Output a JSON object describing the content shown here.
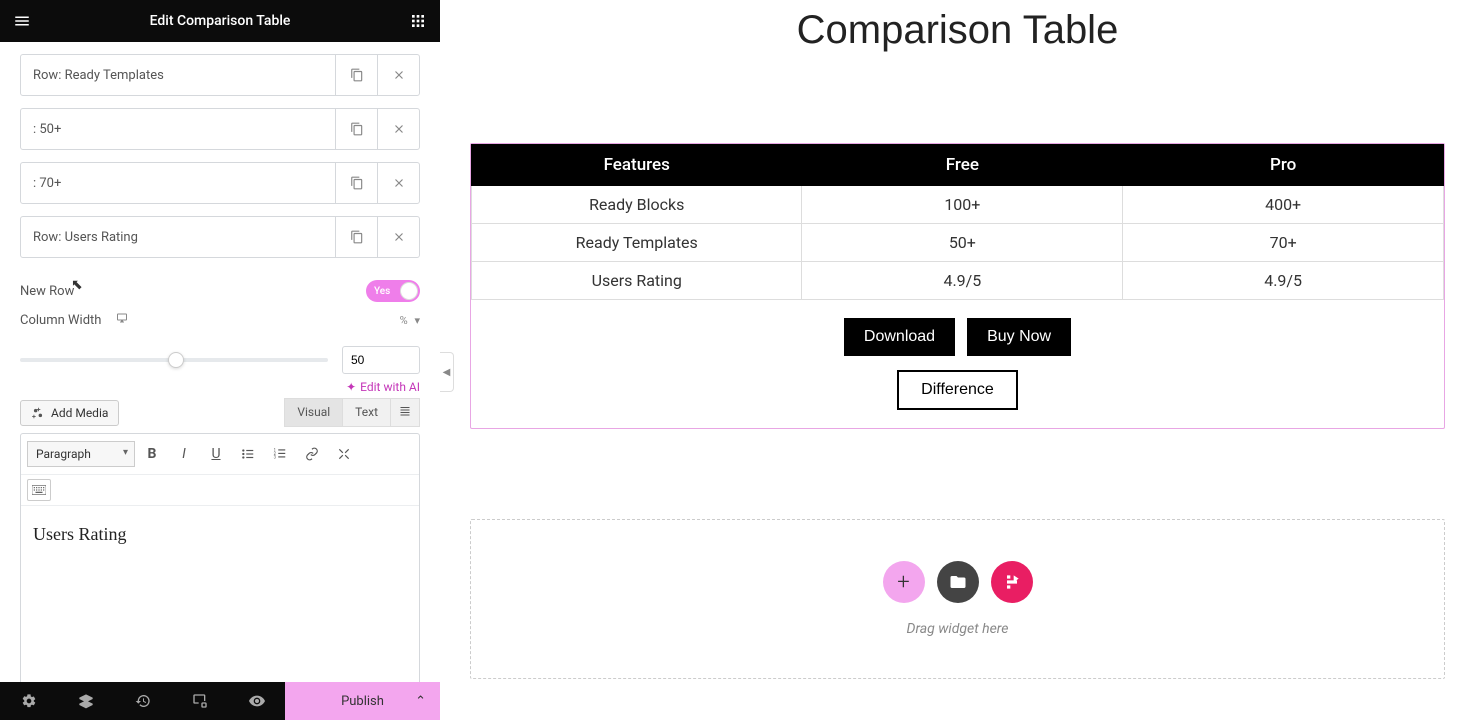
{
  "sidebar": {
    "title": "Edit Comparison Table",
    "rows": [
      {
        "label": "Row: Ready Templates"
      },
      {
        "label": ": 50+"
      },
      {
        "label": ": 70+"
      },
      {
        "label": "Row: Users Rating"
      }
    ],
    "new_row_label": "New Row",
    "new_row_toggle": "Yes",
    "column_width_label": "Column Width",
    "unit": "%",
    "slider_value": "50",
    "edit_ai": "Edit with AI",
    "add_media": "Add Media",
    "tab_visual": "Visual",
    "tab_text": "Text",
    "format_select": "Paragraph",
    "editor_content": "Users Rating"
  },
  "footer": {
    "publish": "Publish"
  },
  "canvas": {
    "page_title": "Comparison Table",
    "headers": [
      "Features",
      "Free",
      "Pro"
    ],
    "rows": [
      {
        "c0": "Ready Blocks",
        "c1": "100+",
        "c2": "400+"
      },
      {
        "c0": "Ready Templates",
        "c1": "50+",
        "c2": "70+"
      },
      {
        "c0": "Users Rating",
        "c1": "4.9/5",
        "c2": "4.9/5"
      }
    ],
    "btn_download": "Download",
    "btn_buy": "Buy Now",
    "btn_difference": "Difference",
    "dropzone_text": "Drag widget here"
  },
  "chart_data": {
    "type": "table",
    "title": "Comparison Table",
    "columns": [
      "Features",
      "Free",
      "Pro"
    ],
    "rows": [
      [
        "Ready Blocks",
        "100+",
        "400+"
      ],
      [
        "Ready Templates",
        "50+",
        "70+"
      ],
      [
        "Users Rating",
        "4.9/5",
        "4.9/5"
      ]
    ]
  }
}
